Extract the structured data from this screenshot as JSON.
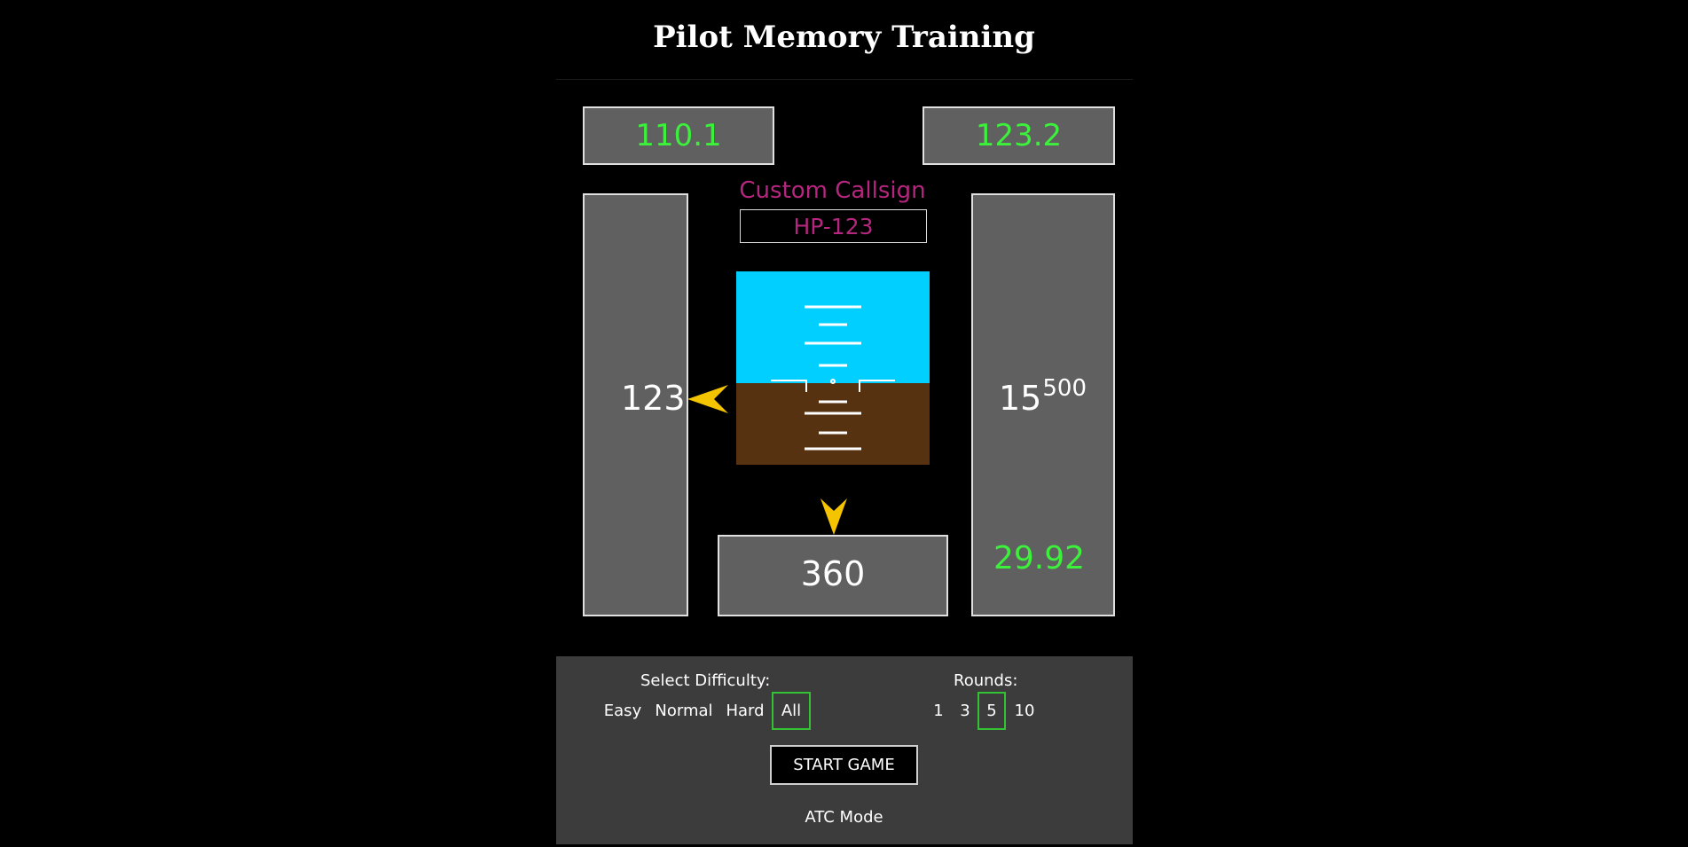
{
  "title": "Pilot Memory Training",
  "instruments": {
    "nav_frequency": "110.1",
    "com_frequency": "123.2",
    "callsign_label": "Custom Callsign",
    "callsign": "HP-123",
    "airspeed": "123",
    "altitude_thousands": "15",
    "altitude_hundreds": "500",
    "barometer": "29.92",
    "heading": "360"
  },
  "colors": {
    "sky": "#00cfff",
    "ground": "#573211",
    "frequency_green": "#3cf03c",
    "callsign_magenta": "#b5267e",
    "pointer_yellow": "#f5c400",
    "selected_border": "#34c234"
  },
  "settings": {
    "difficulty_label": "Select Difficulty:",
    "difficulty_options": [
      "Easy",
      "Normal",
      "Hard",
      "All"
    ],
    "difficulty_selected": "All",
    "rounds_label": "Rounds:",
    "rounds_options": [
      "1",
      "3",
      "5",
      "10"
    ],
    "rounds_selected": "5",
    "start_label": "START GAME",
    "atc_mode_label": "ATC Mode"
  }
}
